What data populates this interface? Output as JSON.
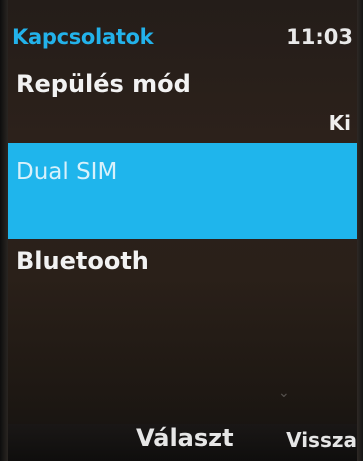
{
  "status_bar": {
    "title": "Kapcsolatok",
    "time": "11:03"
  },
  "menu": {
    "items": [
      {
        "label": "Repülés mód",
        "value": "Ki",
        "selected": false
      },
      {
        "label": "Dual SIM",
        "selected": true
      },
      {
        "label": "Bluetooth",
        "selected": false
      }
    ]
  },
  "softkeys": {
    "center": "Választ",
    "right": "Vissza"
  },
  "colors": {
    "accent": "#1fb5ec",
    "title": "#23b2ea",
    "background": "#2a2019"
  }
}
